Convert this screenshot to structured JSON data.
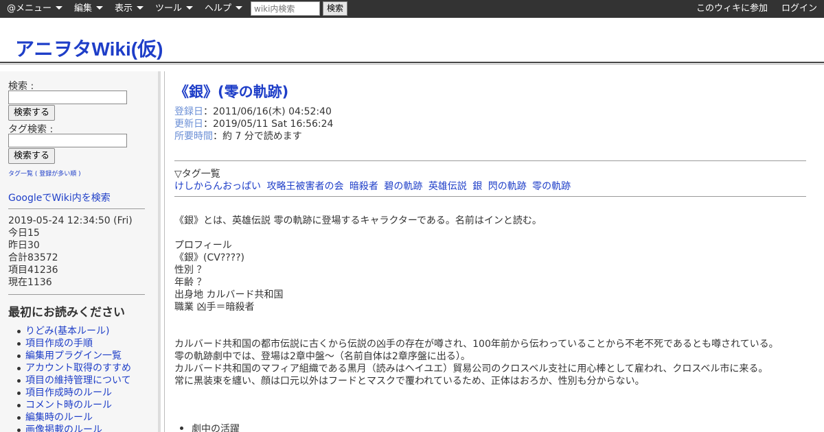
{
  "topbar": {
    "menu": [
      {
        "label": "@メニュー"
      },
      {
        "label": "編集"
      },
      {
        "label": "表示"
      },
      {
        "label": "ツール"
      },
      {
        "label": "ヘルプ"
      }
    ],
    "search_placeholder": "wiki内検索",
    "search_button": "検索",
    "join": "このウィキに参加",
    "login": "ログイン"
  },
  "site": {
    "title": "アニヲタWiki(仮)"
  },
  "sidebar": {
    "search_label": "検索 :",
    "search_button": "検索する",
    "tag_search_label": "タグ検索 :",
    "tag_search_button": "検索する",
    "tag_list_link": "タグ一覧",
    "tag_sort_link": "登録が多い順",
    "google_link": "GoogleでWiki内を検索",
    "stats": {
      "datetime": "2019-05-24 12:34:50 (Fri)",
      "today": "今日15",
      "yesterday": "昨日30",
      "total": "合計83572",
      "items": "項目41236",
      "now": "現在1136"
    },
    "read_first_heading": "最初にお読みください",
    "read_first_items": [
      "りどみ(基本ルール)",
      "項目作成の手順",
      "編集用プラグイン一覧",
      "アカウント取得のすすめ",
      "項目の維持管理について",
      "項目作成時のルール",
      "コメント時のルール",
      "編集時のルール",
      "画像掲載のルール"
    ]
  },
  "article": {
    "title": "《銀》(零の軌跡)",
    "meta": {
      "registered_key": "登録日",
      "registered_value": "：2011/06/16(木) 04:52:40",
      "updated_key": "更新日",
      "updated_value": "：2019/05/11 Sat 16:56:24",
      "read_time_key": "所要時間",
      "read_time_value": "：約 7 分で読めます"
    },
    "tag_heading": "▽タグ一覧",
    "tags": [
      "けしからんおっぱい",
      "攻略王被害者の会",
      "暗殺者",
      "碧の軌跡",
      "英雄伝説",
      "銀",
      "閃の軌跡",
      "零の軌跡"
    ],
    "intro": "《銀》とは、英雄伝説 零の軌跡に登場するキャラクターである。名前はインと読む。",
    "profile": {
      "heading": "プロフィール",
      "name": "《銀》(CV????)",
      "gender": "性別 ？",
      "age": "年齢 ？",
      "origin": "出身地 カルバード共和国",
      "job": "職業 凶手＝暗殺者"
    },
    "paragraphs": [
      "カルバード共和国の都市伝説に古くから伝説の凶手の存在が噂され、100年前から伝わっていることから不老不死であるとも噂されている。",
      "零の軌跡劇中では、登場は2章中盤～（名前自体は2章序盤に出る）。",
      "カルバード共和国のマフィア組織である黒月（読みはヘイユエ）貿易公司のクロスベル支社に用心棒として雇われ、クロスベル市に来る。",
      "常に黒装束を纏い、顔は口元以外はフードとマスクで覆われているため、正体はおろか、性別も分からない。"
    ],
    "section_bullet": "劇中の活躍"
  }
}
